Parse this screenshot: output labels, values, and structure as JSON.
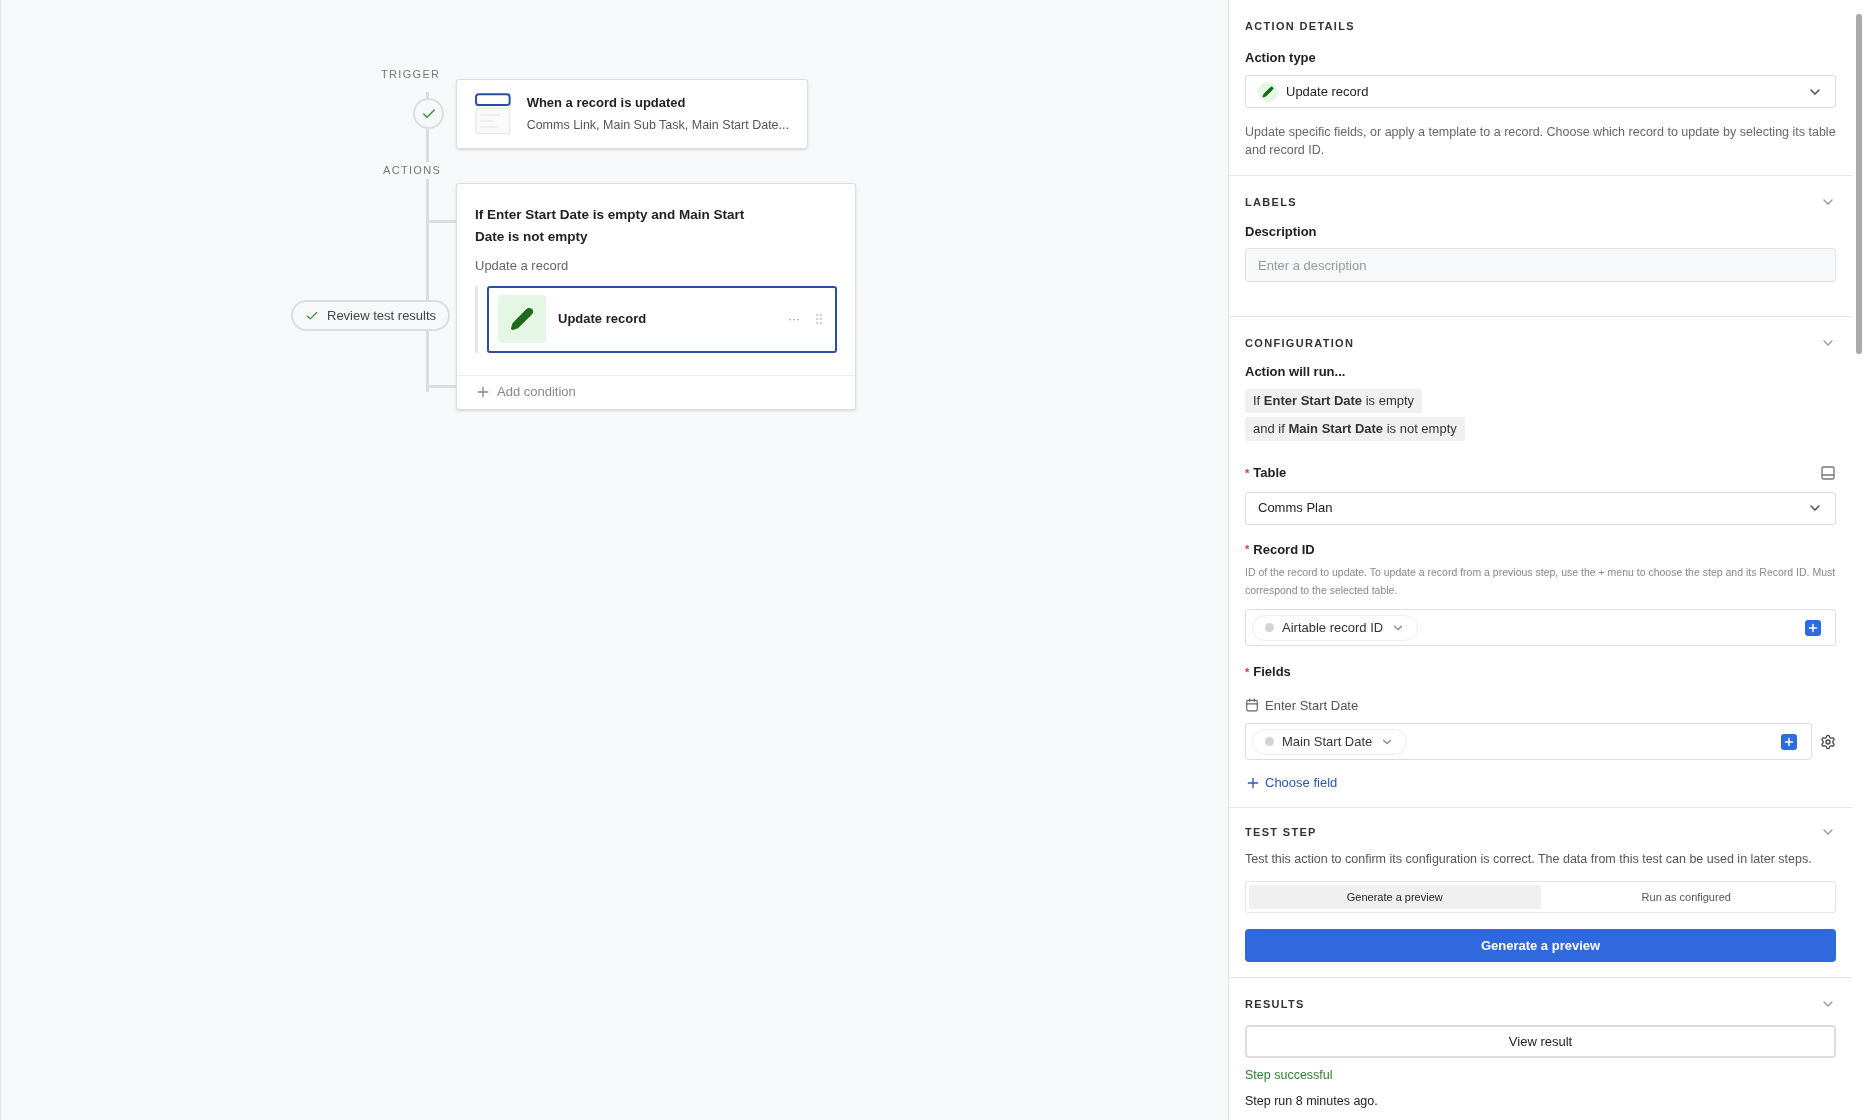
{
  "canvas": {
    "trigger_label": "TRIGGER",
    "actions_label": "ACTIONS",
    "trigger": {
      "title": "When a record is updated",
      "subtitle": "Comms Link, Main Sub Task, Main Start Date..."
    },
    "review_button": "Review test results",
    "condition_group": {
      "title": "If Enter Start Date is empty and Main Start Date is not empty",
      "subtitle": "Update a record",
      "action": {
        "label": "Update record",
        "selected": true,
        "more": "···"
      },
      "add_condition": "Add condition"
    }
  },
  "panel": {
    "action_details": {
      "heading": "ACTION DETAILS",
      "label": "Action type",
      "value": "Update record",
      "description": "Update specific fields, or apply a template to a record. Choose which record to update by selecting its table and record ID."
    },
    "labels": {
      "heading": "LABELS",
      "label": "Description",
      "placeholder": "Enter a description"
    },
    "configuration": {
      "heading": "CONFIGURATION",
      "run_label": "Action will run...",
      "conditions": [
        "If **Enter Start Date** is empty",
        "and if **Main Start Date** is not empty"
      ],
      "table": {
        "required": "*",
        "label": "Table",
        "value": "Comms Plan"
      },
      "record_id": {
        "required": "*",
        "label": "Record ID",
        "help": "ID of the record to update. To update a record from a previous step, use the + menu to choose the step and its Record ID. Must correspond to the selected table.",
        "token": "Airtable record ID"
      },
      "fields": {
        "required": "*",
        "label": "Fields",
        "items": [
          {
            "name": "Enter Start Date",
            "token": "Main Start Date"
          }
        ],
        "choose": "Choose field"
      }
    },
    "test_step": {
      "heading": "TEST STEP",
      "description": "Test this action to confirm its configuration is correct. The data from this test can be used in later steps.",
      "modes": [
        {
          "label": "Generate a preview",
          "selected": true
        },
        {
          "label": "Run as configured",
          "selected": false
        }
      ],
      "button": "Generate a preview"
    },
    "results": {
      "heading": "RESULTS",
      "button": "View result",
      "status": "Step successful",
      "time": "Step run 8 minutes ago."
    }
  }
}
